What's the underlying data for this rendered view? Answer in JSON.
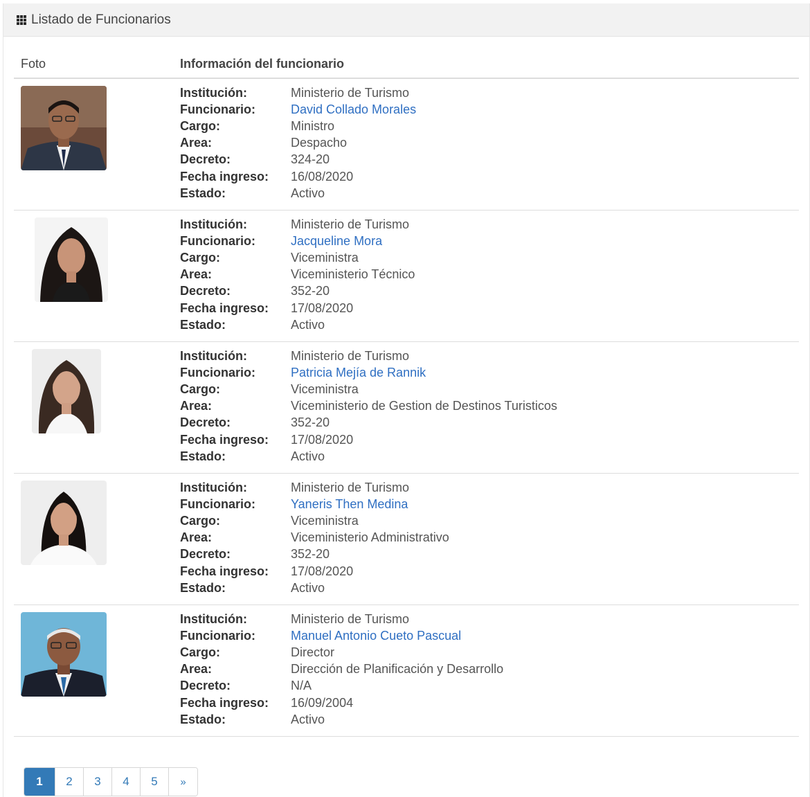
{
  "panel": {
    "title": "Listado de Funcionarios"
  },
  "table": {
    "col_foto": "Foto",
    "col_info": "Información del funcionario"
  },
  "labels": {
    "institucion": "Institución:",
    "funcionario": "Funcionario:",
    "cargo": "Cargo:",
    "area": "Area:",
    "decreto": "Decreto:",
    "fecha": "Fecha ingreso:",
    "estado": "Estado:"
  },
  "rows": [
    {
      "institucion": "Ministerio de Turismo",
      "funcionario": "David Collado Morales",
      "cargo": "Ministro",
      "area": "Despacho",
      "decreto": "324-20",
      "fecha": "16/08/2020",
      "estado": "Activo"
    },
    {
      "institucion": "Ministerio de Turismo",
      "funcionario": "Jacqueline Mora",
      "cargo": "Viceministra",
      "area": "Viceministerio Técnico",
      "decreto": "352-20",
      "fecha": "17/08/2020",
      "estado": "Activo"
    },
    {
      "institucion": "Ministerio de Turismo",
      "funcionario": "Patricia Mejía de Rannik",
      "cargo": "Viceministra",
      "area": "Viceministerio de Gestion de Destinos Turisticos",
      "decreto": "352-20",
      "fecha": "17/08/2020",
      "estado": "Activo"
    },
    {
      "institucion": "Ministerio de Turismo",
      "funcionario": "Yaneris Then Medina",
      "cargo": "Viceministra",
      "area": "Viceministerio Administrativo",
      "decreto": "352-20",
      "fecha": "17/08/2020",
      "estado": "Activo"
    },
    {
      "institucion": "Ministerio de Turismo",
      "funcionario": "Manuel Antonio Cueto Pascual",
      "cargo": "Director",
      "area": "Dirección de Planificación y Desarrollo",
      "decreto": "N/A",
      "fecha": "16/09/2004",
      "estado": "Activo"
    }
  ],
  "pagination": {
    "pages": [
      "1",
      "2",
      "3",
      "4",
      "5"
    ],
    "next": "»",
    "active": "1"
  },
  "colors": {
    "link": "#2f6fc2",
    "active_page": "#337ab7"
  }
}
